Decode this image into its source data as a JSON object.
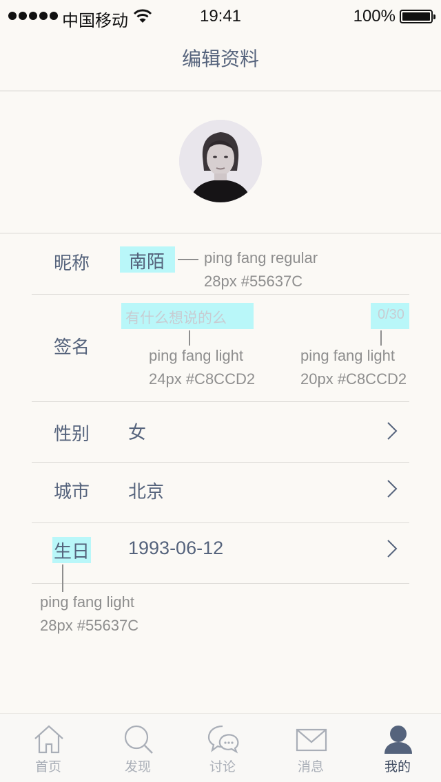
{
  "status_bar": {
    "carrier": "中国移动",
    "time": "19:41",
    "battery": "100%"
  },
  "nav": {
    "title": "编辑资料"
  },
  "form": {
    "nickname": {
      "label": "昵称",
      "value": "南陌"
    },
    "signature": {
      "label": "签名",
      "placeholder": "有什么想说的么",
      "count": "0/30"
    },
    "gender": {
      "label": "性别",
      "value": "女"
    },
    "city": {
      "label": "城市",
      "value": "北京"
    },
    "birthday": {
      "label": "生日",
      "value": "1993-06-12"
    }
  },
  "annotations": {
    "nickname_font": "ping fang regular",
    "nickname_spec": "28px #55637C",
    "placeholder_font": "ping fang light",
    "placeholder_spec": "24px #C8CCD2",
    "count_font": "ping fang light",
    "count_spec": "20px #C8CCD2",
    "label_font": "ping fang light",
    "label_spec": "28px #55637C"
  },
  "tabbar": {
    "tabs": [
      {
        "label": "首页",
        "icon": "home-icon"
      },
      {
        "label": "发现",
        "icon": "search-icon"
      },
      {
        "label": "讨论",
        "icon": "chat-icon"
      },
      {
        "label": "消息",
        "icon": "mail-icon"
      },
      {
        "label": "我的",
        "icon": "user-icon",
        "active": true
      }
    ]
  },
  "colors": {
    "text": "#55637C",
    "placeholder": "#C8CCD2",
    "highlight": "#B9F7F9",
    "background": "#FBF9F5"
  }
}
